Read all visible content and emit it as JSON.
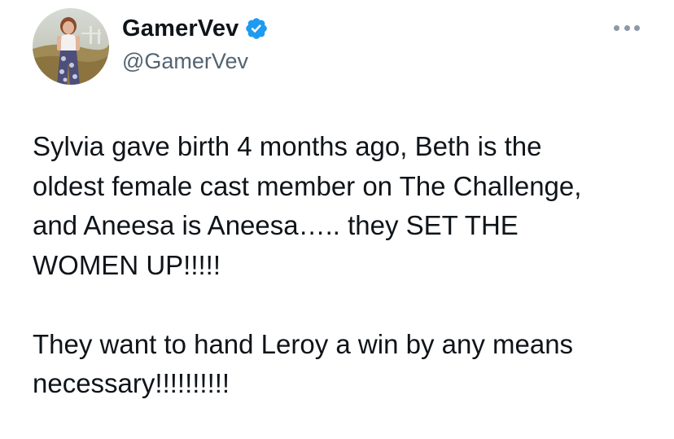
{
  "author": {
    "display_name": "GamerVev",
    "handle": "@GamerVev",
    "verified": true
  },
  "tweet": {
    "paragraphs": [
      "Sylvia gave birth 4 months ago, Beth is the\noldest female cast member on The Challenge,\nand Aneesa is Aneesa….. they SET THE\nWOMEN UP!!!!!",
      "They want to hand Leroy a win by any means\nnecessary!!!!!!!!!!"
    ]
  },
  "icons": {
    "verified": "verified-badge-icon",
    "more": "more-options-icon"
  },
  "colors": {
    "verified_blue": "#1d9bf0",
    "handle_gray": "#536471",
    "text": "#0f1419"
  }
}
